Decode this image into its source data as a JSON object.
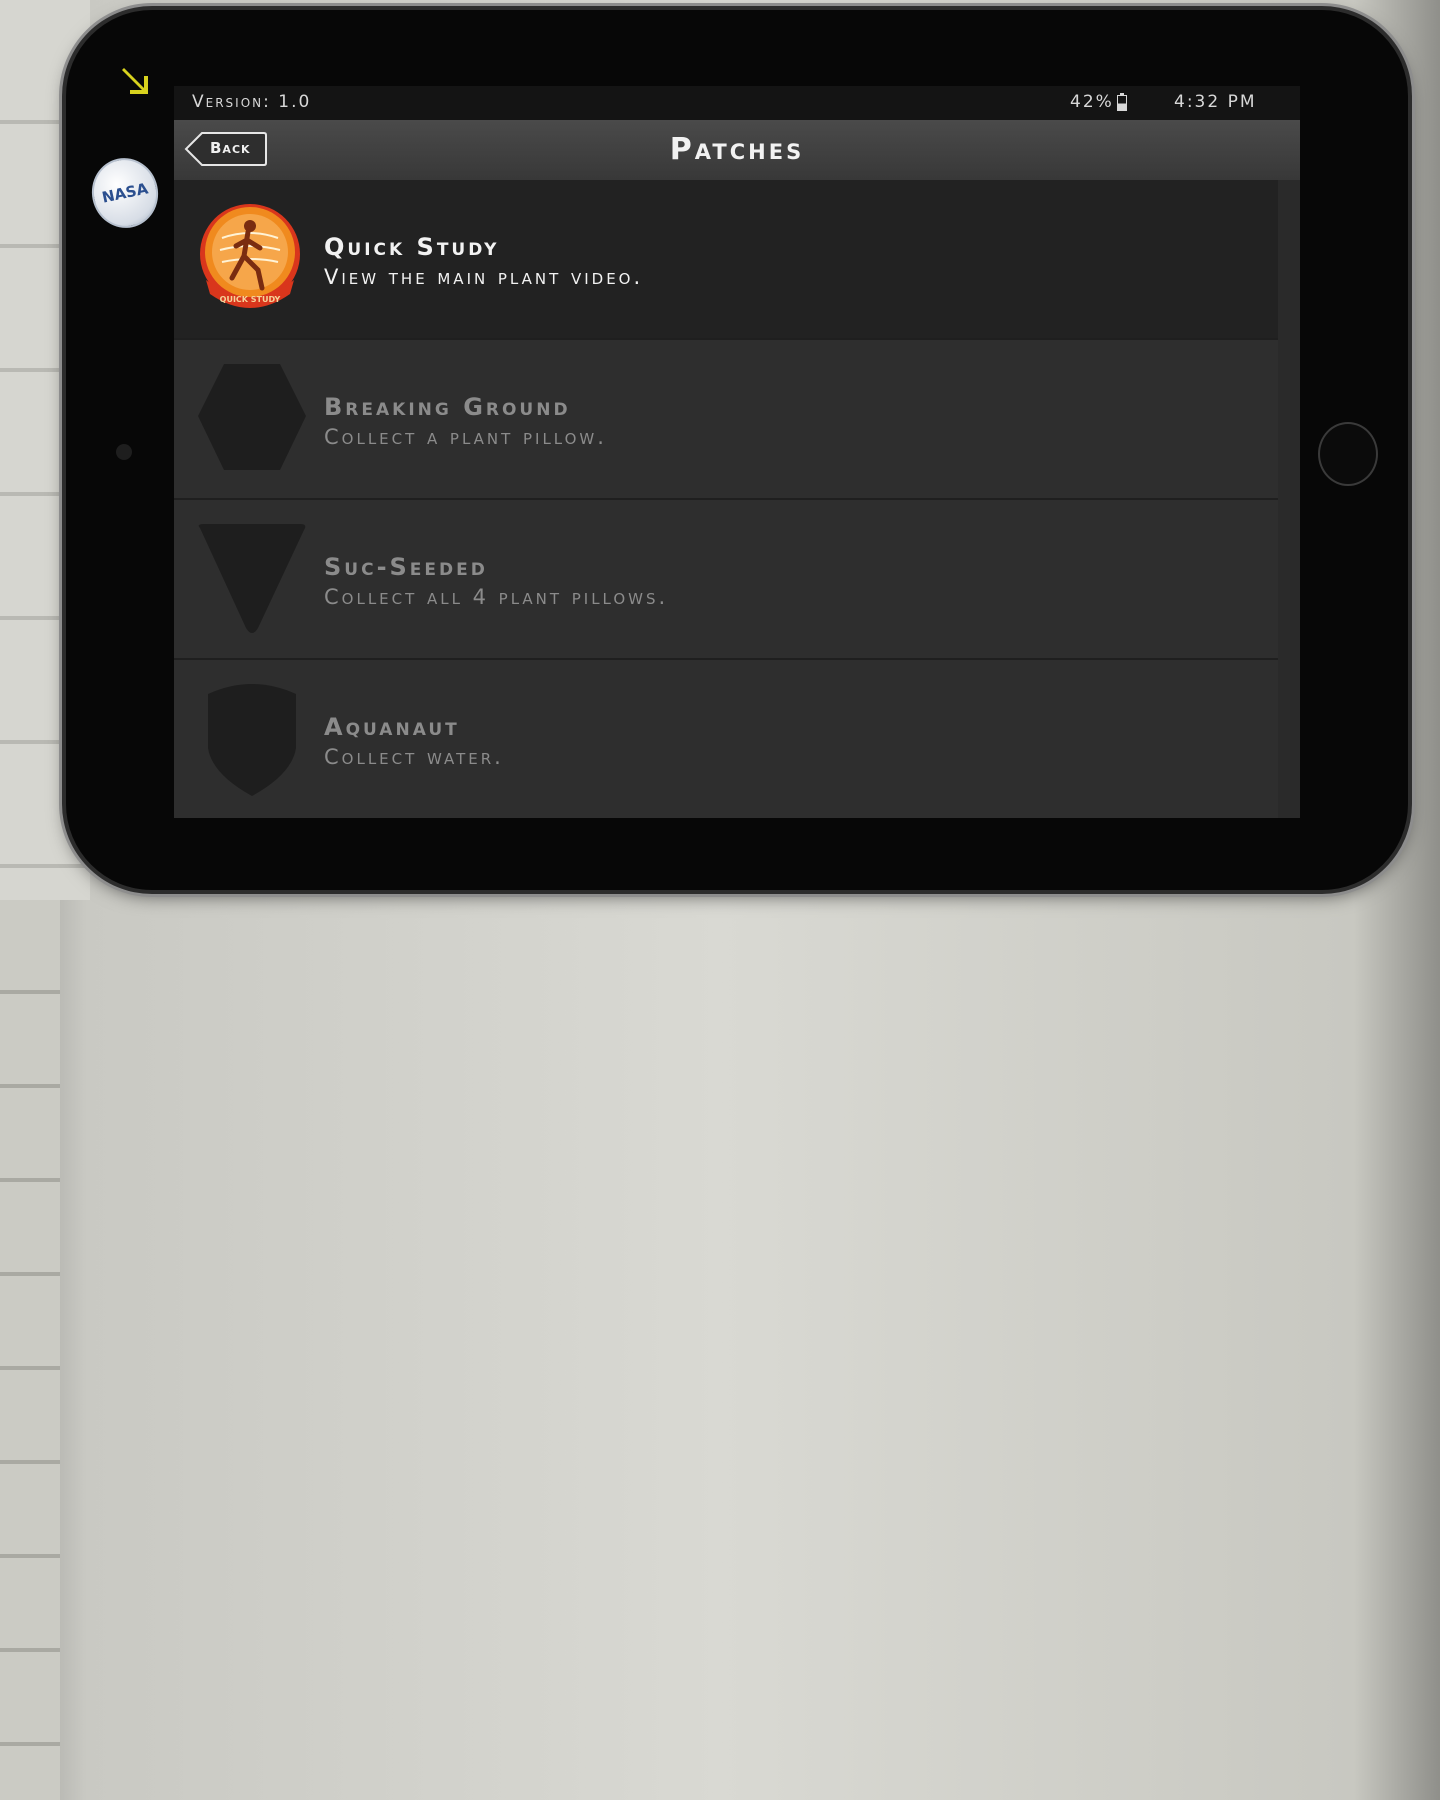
{
  "status_bar": {
    "version": "Version: 1.0",
    "battery": "42%",
    "time": "4:32 PM"
  },
  "nav": {
    "back_label": "Back",
    "title": "Patches"
  },
  "badge": {
    "logo_text": "NASA"
  },
  "patches": [
    {
      "title": "Quick Study",
      "description": "View the main plant video.",
      "unlocked": true,
      "patch_label": "QUICK STUDY"
    },
    {
      "title": "Breaking Ground",
      "description": "Collect a plant pillow.",
      "unlocked": false
    },
    {
      "title": "Suc-Seeded",
      "description": "Collect all 4 plant pillows.",
      "unlocked": false
    },
    {
      "title": "Aquanaut",
      "description": "Collect water.",
      "unlocked": false
    }
  ],
  "colors": {
    "accent_orange": "#f08a1e",
    "patch_red": "#d9361c",
    "locked_shape": "#1e1e1e",
    "arrow_yellow": "#d8d21e"
  },
  "icons": [
    "arrow-icon",
    "battery-icon",
    "back-chevron-icon",
    "quick-study-patch-icon",
    "hexagon-patch-icon",
    "triangle-patch-icon",
    "shield-patch-icon"
  ]
}
